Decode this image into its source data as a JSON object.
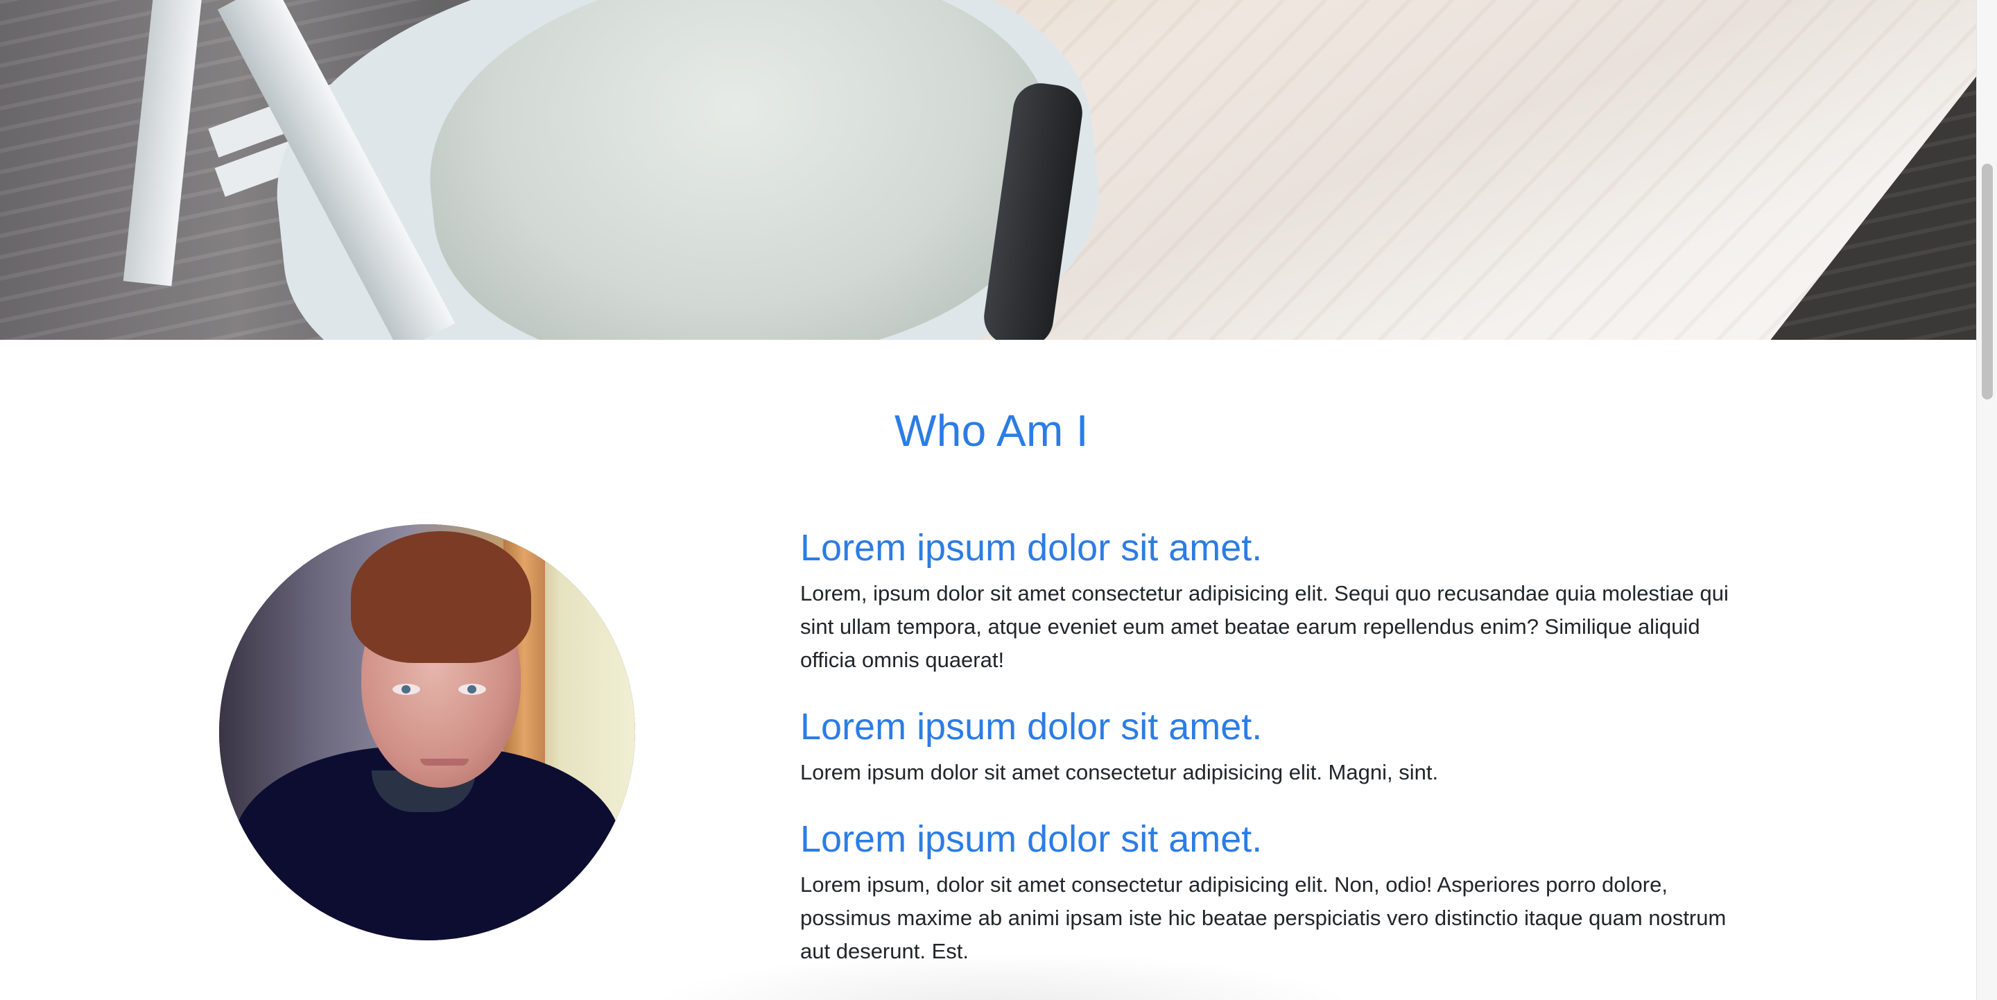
{
  "hero": {
    "image_description_icon": "hero-photo"
  },
  "about": {
    "title": "Who Am I",
    "items": [
      {
        "heading": "Lorem ipsum dolor sit amet.",
        "body": "Lorem, ipsum dolor sit amet consectetur adipisicing elit. Sequi quo recusandae quia molestiae qui sint ullam tempora, atque eveniet eum amet beatae earum repellendus enim? Similique aliquid officia omnis quaerat!"
      },
      {
        "heading": "Lorem ipsum dolor sit amet.",
        "body": "Lorem ipsum dolor sit amet consectetur adipisicing elit. Magni, sint."
      },
      {
        "heading": "Lorem ipsum dolor sit amet.",
        "body": "Lorem ipsum, dolor sit amet consectetur adipisicing elit. Non, odio! Asperiores porro dolore, possimus maxime ab animi ipsam iste hic beatae perspiciatis vero distinctio itaque quam nostrum aut deserunt. Est."
      }
    ]
  },
  "colors": {
    "accent": "#2c7ce5",
    "text": "#212529",
    "background": "#ffffff"
  }
}
